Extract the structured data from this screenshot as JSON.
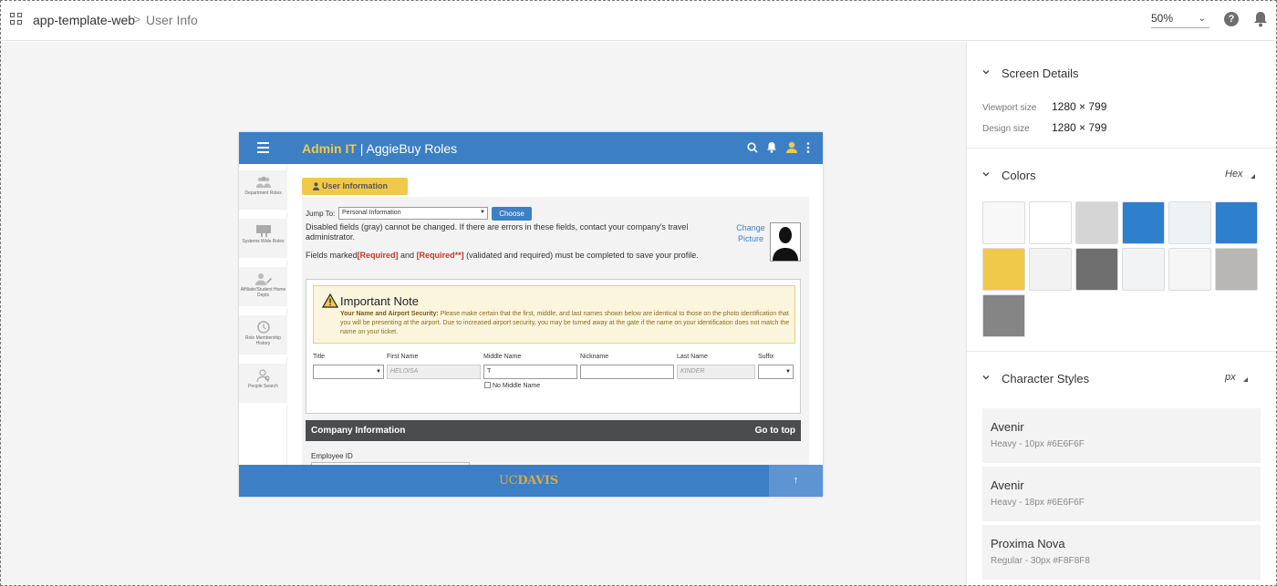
{
  "topbar": {
    "app_name": "app-template-web",
    "separator": ">",
    "page_name": "User Info",
    "zoom": "50%"
  },
  "artboard": {
    "header": {
      "title_accent": "Admin IT",
      "title_rest": " | AggieBuy Roles"
    },
    "sidebar": [
      {
        "label": "Department Roles"
      },
      {
        "label": "Systems Wide Roles"
      },
      {
        "label": "Affiliate/Student Home Depts"
      },
      {
        "label": "Role Membership History"
      },
      {
        "label": "People Search"
      }
    ],
    "tab_label": "User Information",
    "jump_label": "Jump To:",
    "jump_value": "Personal Information",
    "choose_label": "Choose",
    "info_disabled": "Disabled fields (gray) cannot be changed. If there are errors in these fields, contact your company's travel administrator.",
    "info_required_prefix": "Fields marked",
    "req1": "[Required]",
    "info_and": " and ",
    "req2": "[Required**]",
    "info_required_suffix": " (validated and required) must be completed to save your profile.",
    "change_picture": "Change Picture",
    "note": {
      "title": "Important Note",
      "bold": "Your Name and Airport Security:",
      "body": " Please make certain that the first, middle, and last names shown below are identical to those on the photo identification that you will be presenting at the airport. Due to increased airport security, you may be turned away at the gate if the name on your identification does not match the name on your ticket."
    },
    "fields": {
      "title_label": "Title",
      "first_label": "First Name",
      "first_value": "HELOISA",
      "middle_label": "Middle Name",
      "middle_value": "T",
      "nickname_label": "Nickname",
      "last_label": "Last Name",
      "last_value": "KINDER",
      "suffix_label": "Suffix",
      "no_middle": "No Middle Name"
    },
    "company_header": "Company Information",
    "go_top": "Go to top",
    "employee_id_label": "Employee ID",
    "footer_uc": "UC",
    "footer_davis": "DAVIS",
    "up_arrow": "↑"
  },
  "panel": {
    "screen_details": {
      "title": "Screen Details",
      "viewport_label": "Viewport size",
      "viewport_value": "1280 × 799",
      "design_label": "Design size",
      "design_value": "1280 × 799"
    },
    "colors": {
      "title": "Colors",
      "unit": "Hex",
      "swatches": [
        "#F8F8F8",
        "#FFFFFF",
        "#D5D5D5",
        "#2F80CC",
        "#EEF2F5",
        "#2F80CC",
        "#F0C94A",
        "#F2F2F2",
        "#6E6E6E",
        "#F1F3F5",
        "#F5F5F5",
        "#B9B7B6",
        "#858585"
      ]
    },
    "char_styles": {
      "title": "Character Styles",
      "unit": "px",
      "items": [
        {
          "name": "Avenir",
          "desc": "Heavy - 10px #6E6F6F"
        },
        {
          "name": "Avenir",
          "desc": "Heavy - 18px #6E6F6F"
        },
        {
          "name": "Proxima Nova",
          "desc": "Regular - 30px #F8F8F8"
        }
      ]
    }
  }
}
